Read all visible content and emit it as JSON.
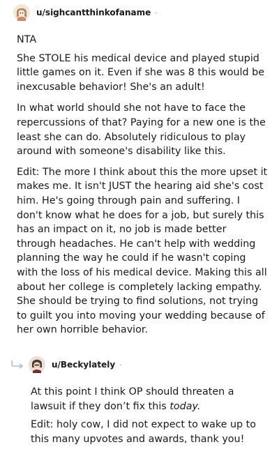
{
  "comment1": {
    "username": "u/sighcantthinkofaname",
    "separator": "·",
    "paragraphs": [
      "NTA",
      "She STOLE his medical device and played stupid little games on it. Even if she was 8 this would be inexcusable behavior! She's an adult!",
      "In what world should she not have to face the repercussions of that? Paying for a new one is the least she can do. Absolutely ridiculous to play around with someone's disability like this.",
      "Edit: The more I think about this the more upset it makes me. It isn't JUST the hearing aid she's cost him. He's going through pain and suffering. I don't know what he does for a job, but surely this has an impact on it, no job is made better through headaches. He can't help with wedding planning the way he could if he wasn't coping with the loss of his medical device. Making this all about her college is completely lacking empathy. She should be trying to find solutions, not trying to guilt you into moving your wedding because of her own horrible behavior."
    ]
  },
  "comment2": {
    "username": "u/Beckylately",
    "separator": "·",
    "p1_main": "At this point I think OP should threaten a lawsuit if they don’t fix this ",
    "p1_emph": "today.",
    "p2": "Edit: holy cow, I did not expect to wake up to this many upvotes and awards, thank you!"
  },
  "colors": {
    "text": "#1a1a1b",
    "meta": "#878a8c",
    "reply_arrow": "#a8c0d8"
  },
  "icons": [
    "avatar-snoo",
    "reply-arrow-icon"
  ]
}
